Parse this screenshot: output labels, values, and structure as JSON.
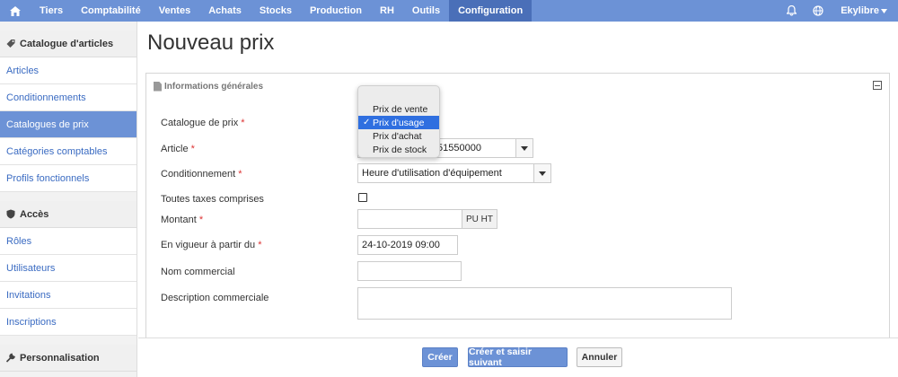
{
  "topnav": {
    "home_icon": "home-icon",
    "items": [
      "Tiers",
      "Comptabilité",
      "Ventes",
      "Achats",
      "Stocks",
      "Production",
      "RH",
      "Outils",
      "Configuration"
    ],
    "active": "Configuration",
    "user": "Ekylibre",
    "accent": "#6c92d6"
  },
  "sidebar": {
    "sections": [
      {
        "title": "Catalogue d'articles",
        "icon": "tag-icon",
        "items": [
          "Articles",
          "Conditionnements",
          "Catalogues de prix",
          "Catégories comptables",
          "Profils fonctionnels"
        ]
      },
      {
        "title": "Accès",
        "icon": "shield-icon",
        "items": [
          "Rôles",
          "Utilisateurs",
          "Invitations",
          "Inscriptions"
        ]
      },
      {
        "title": "Personnalisation",
        "icon": "wrench-icon",
        "items": []
      }
    ],
    "active_item": "Catalogues de prix"
  },
  "page": {
    "title": "Nouveau prix"
  },
  "panel": {
    "title": "Informations générales",
    "labels": {
      "catalogue": "Catalogue de prix",
      "article": "Article",
      "conditionnement": "Conditionnement",
      "ttc": "Toutes taxes comprises",
      "montant": "Montant",
      "vigueur": "En vigueur à partir du",
      "nom": "Nom commercial",
      "description": "Description commerciale"
    },
    "required_mark": "*",
    "values": {
      "article_partial": "51550000",
      "conditionnement": "Heure d'utilisation d'équipement",
      "montant": "",
      "montant_unit": "PU HT",
      "vigueur": "24-10-2019 09:00",
      "nom": "",
      "description": ""
    },
    "dropdown": {
      "options": [
        "Prix de vente",
        "Prix d'usage",
        "Prix d'achat",
        "Prix de stock"
      ],
      "selected": "Prix d'usage",
      "check": "✓"
    }
  },
  "footer": {
    "create": "Créer",
    "create_next": "Créer et saisir suivant",
    "cancel": "Annuler"
  }
}
